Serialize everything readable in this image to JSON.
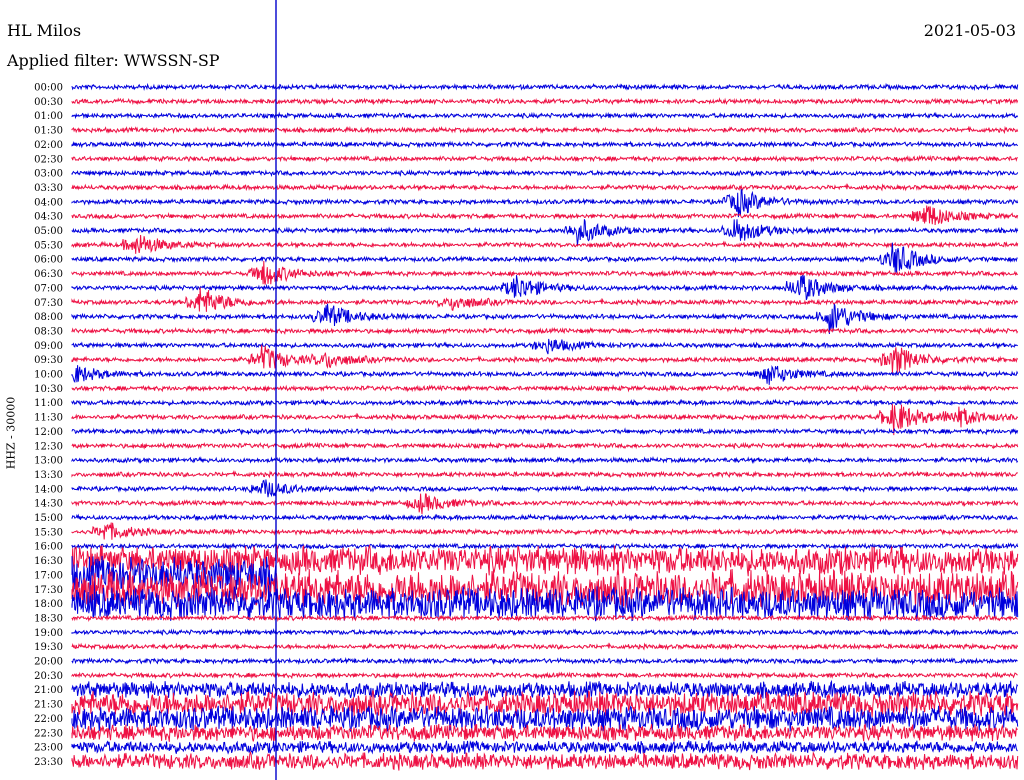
{
  "header": {
    "station": "HL Milos",
    "date": "2021-05-03",
    "filter": "Applied filter: WWSSN-SP"
  },
  "chart_data": {
    "type": "line",
    "title": "HL Milos",
    "ylabel": "HHZ - 30000",
    "row_labels": [
      "00:00",
      "00:30",
      "01:00",
      "01:30",
      "02:00",
      "02:30",
      "03:00",
      "03:30",
      "04:00",
      "04:30",
      "05:00",
      "05:30",
      "06:00",
      "06:30",
      "07:00",
      "07:30",
      "08:00",
      "08:30",
      "09:00",
      "09:30",
      "10:00",
      "10:30",
      "11:00",
      "11:30",
      "12:00",
      "12:30",
      "13:00",
      "13:30",
      "14:00",
      "14:30",
      "15:00",
      "15:30",
      "16:00",
      "16:30",
      "17:00",
      "17:30",
      "18:00",
      "18:30",
      "19:00",
      "19:30",
      "20:00",
      "20:30",
      "21:00",
      "21:30",
      "22:00",
      "22:30",
      "23:00",
      "23:30"
    ],
    "series_colors": [
      "#0000dd",
      "#ee1144"
    ],
    "time_marker_color": "#0000cc",
    "time_marker_row": "17:00",
    "events": [
      {
        "row": "04:00",
        "minute": 21,
        "amp": 16
      },
      {
        "row": "04:30",
        "minute": 27,
        "amp": 14
      },
      {
        "row": "05:00",
        "minute": 16,
        "amp": 14
      },
      {
        "row": "05:00",
        "minute": 21,
        "amp": 14
      },
      {
        "row": "05:30",
        "minute": 2,
        "amp": 12
      },
      {
        "row": "06:00",
        "minute": 26,
        "amp": 18
      },
      {
        "row": "06:30",
        "minute": 6,
        "amp": 14
      },
      {
        "row": "07:00",
        "minute": 14,
        "amp": 14
      },
      {
        "row": "07:00",
        "minute": 23,
        "amp": 16
      },
      {
        "row": "07:30",
        "minute": 4,
        "amp": 16
      },
      {
        "row": "07:30",
        "minute": 12,
        "amp": 8
      },
      {
        "row": "08:00",
        "minute": 8,
        "amp": 14
      },
      {
        "row": "08:00",
        "minute": 24,
        "amp": 18
      },
      {
        "row": "09:00",
        "minute": 15,
        "amp": 8
      },
      {
        "row": "09:30",
        "minute": 6,
        "amp": 14
      },
      {
        "row": "09:30",
        "minute": 8,
        "amp": 8
      },
      {
        "row": "09:30",
        "minute": 26,
        "amp": 16
      },
      {
        "row": "10:00",
        "minute": 0,
        "amp": 10
      },
      {
        "row": "10:00",
        "minute": 22,
        "amp": 12
      },
      {
        "row": "11:30",
        "minute": 26,
        "amp": 18
      },
      {
        "row": "11:30",
        "minute": 28,
        "amp": 10
      },
      {
        "row": "14:00",
        "minute": 6,
        "amp": 10
      },
      {
        "row": "14:30",
        "minute": 11,
        "amp": 10
      },
      {
        "row": "15:30",
        "minute": 1,
        "amp": 10
      }
    ],
    "noise_rows": {
      "16:30": 14,
      "17:00": 18,
      "17:30": 18,
      "18:00": 16,
      "21:00": 8,
      "21:30": 12,
      "22:00": 12,
      "22:30": 8,
      "23:00": 6,
      "23:30": 8
    }
  }
}
